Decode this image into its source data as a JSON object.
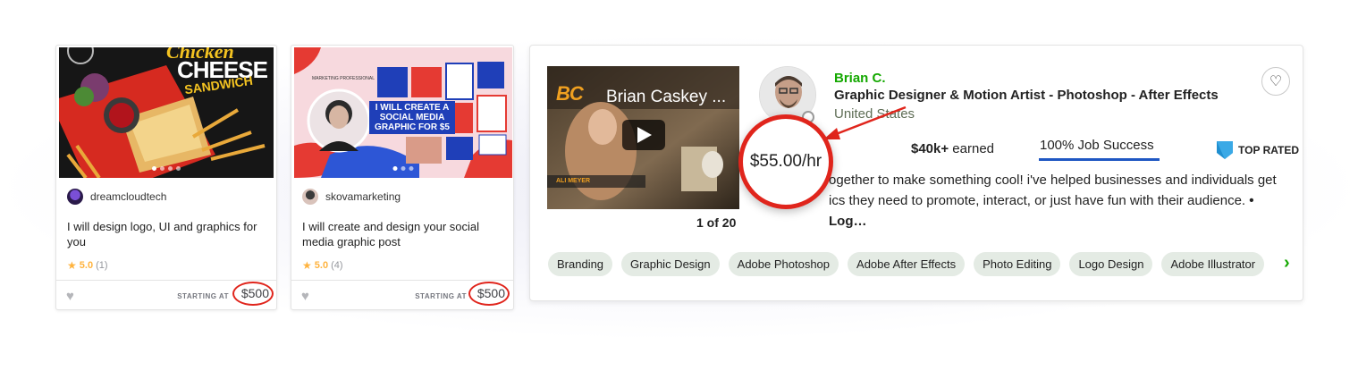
{
  "gigs": [
    {
      "seller": "dreamcloudtech",
      "title": "I will design logo, UI and graphics for you",
      "rating": "5.0",
      "reviews": "(1)",
      "starting_label": "STARTING AT",
      "price": "$500",
      "thumb_text": {
        "top": "Chicken",
        "mid": "CHEESE",
        "low": "SANDWICH"
      }
    },
    {
      "seller": "skovamarketing",
      "title": "I will create and design your social media graphic post",
      "rating": "5.0",
      "reviews": "(4)",
      "starting_label": "STARTING AT",
      "price": "$500",
      "thumb_text": {
        "small": "MARKETING PROFESSIONAL",
        "l1": "I WILL CREATE A",
        "l2": "SOCIAL MEDIA",
        "l3": "GRAPHIC FOR $5"
      }
    }
  ],
  "freelancer": {
    "name": "Brian C.",
    "title": "Graphic Designer & Motion Artist - Photoshop - After Effects",
    "location": "United States",
    "rate": "$55.00/hr",
    "earned_amount": "$40k+",
    "earned_label": " earned",
    "job_success": "100% Job Success",
    "badge": "TOP RATED",
    "bio_line1": "ogether to make something cool! i've helped businesses and individuals get",
    "bio_line2": "ics they need to promote, interact, or just have fun with their audience. ",
    "bio_more": "• Log…",
    "video_title": "Brian Caskey ...",
    "video_logo": "BC",
    "video_caption": "ALI MEYER",
    "pager": "1 of 20",
    "skills": [
      "Branding",
      "Graphic Design",
      "Adobe Photoshop",
      "Adobe After Effects",
      "Photo Editing",
      "Logo Design",
      "Adobe Illustrator"
    ]
  },
  "icons": {
    "heart": "heart-icon",
    "star": "star-icon",
    "play": "play-icon",
    "chevron": "chevron-right-icon",
    "badge": "top-rated-badge-icon"
  },
  "colors": {
    "accent_green": "#14a800",
    "annotation_red": "#e0251c",
    "job_success_blue": "#1f57c3",
    "star": "#ffb33e"
  }
}
